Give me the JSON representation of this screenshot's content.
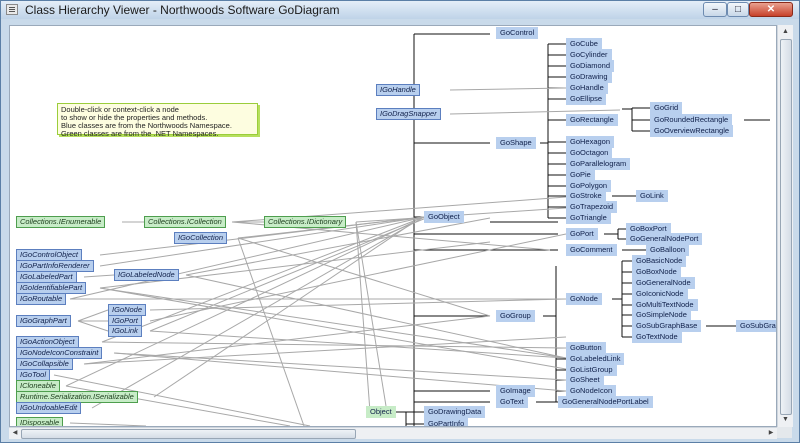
{
  "window": {
    "title": "Class Hierarchy Viewer - Northwoods Software GoDiagram"
  },
  "note": {
    "lines": [
      "Double-click or context-click a node",
      "to show or hide the properties and methods.",
      "Blue classes are from the Northwoods Namespace.",
      "Green classes are from the .NET Namespaces."
    ]
  },
  "nodes": {
    "gocontrol": "GoControl",
    "igohandle": "IGoHandle",
    "igodragsnapper": "IGoDragSnapper",
    "gocube": "GoCube",
    "gocylinder": "GoCylinder",
    "godiamond": "GoDiamond",
    "godrawing": "GoDrawing",
    "gohandle": "GoHandle",
    "goellipse": "GoEllipse",
    "gorectangle": "GoRectangle",
    "gogrid": "GoGrid",
    "goroundedrectangle": "GoRoundedRectangle",
    "gooverviewrectangle": "GoOverviewRectangle",
    "goshape": "GoShape",
    "gohexagon": "GoHexagon",
    "gooctagon": "GoOctagon",
    "goparallelogram": "GoParallelogram",
    "gopie": "GoPie",
    "gopolygon": "GoPolygon",
    "gostroke": "GoStroke",
    "golink": "GoLink",
    "gotrapezoid": "GoTrapezoid",
    "gotriangle": "GoTriangle",
    "goobject": "GoObject",
    "goport": "GoPort",
    "goboxport": "GoBoxPort",
    "gogeneralnodeport": "GoGeneralNodePort",
    "gocomment": "GoComment",
    "goballoon": "GoBalloon",
    "gobasicnode": "GoBasicNode",
    "goboxnode": "GoBoxNode",
    "gogeneralnode": "GoGeneralNode",
    "goiconicnode": "GoIconicNode",
    "gonode": "GoNode",
    "gomultitextnode": "GoMultiTextNode",
    "gosimplenode": "GoSimpleNode",
    "gosubgraphbase": "GoSubGraphBase",
    "gosubgraph": "GoSubGra",
    "gotextnode": "GoTextNode",
    "gogroup": "GoGroup",
    "gobutton": "GoButton",
    "golabeledlink": "GoLabeledLink",
    "golistgroup": "GoListGroup",
    "gosheet": "GoSheet",
    "goimage": "GoImage",
    "gonodeicon": "GoNodeIcon",
    "gotext": "GoText",
    "gogeneralnodeportlabel": "GoGeneralNodePortLabel",
    "object": "Object",
    "godrawingdata": "GoDrawingData",
    "gopartinfo": "GoPartInfo",
    "collections_ienumerable": "Collections.IEnumerable",
    "collections_icollection": "Collections.ICollection",
    "collections_idictionary": "Collections.IDictionary",
    "igocollection": "IGoCollection",
    "igocontrolobject": "IGoControlObject",
    "igopartinforenderer": "IGoPartInfoRenderer",
    "igolabeledpart": "IGoLabeledPart",
    "igolabelednode": "IGoLabeledNode",
    "igoidentifiablepart": "IGoIdentifiablePart",
    "igoroutable": "IGoRoutable",
    "igonode": "IGoNode",
    "igographpart": "IGoGraphPart",
    "igoport": "IGoPort",
    "igolink": "IGoLink",
    "igoactionobject": "IGoActionObject",
    "igonodeiconconstraint": "IGoNodeIconConstraint",
    "igocollapsible": "IGoCollapsible",
    "igotool": "IGoTool",
    "icloneable": "ICloneable",
    "runtime_serializable": "Runtime.Serialization.ISerializable",
    "igoundoableedit": "IGoUndoableEdit",
    "idisposable": "IDisposable"
  }
}
